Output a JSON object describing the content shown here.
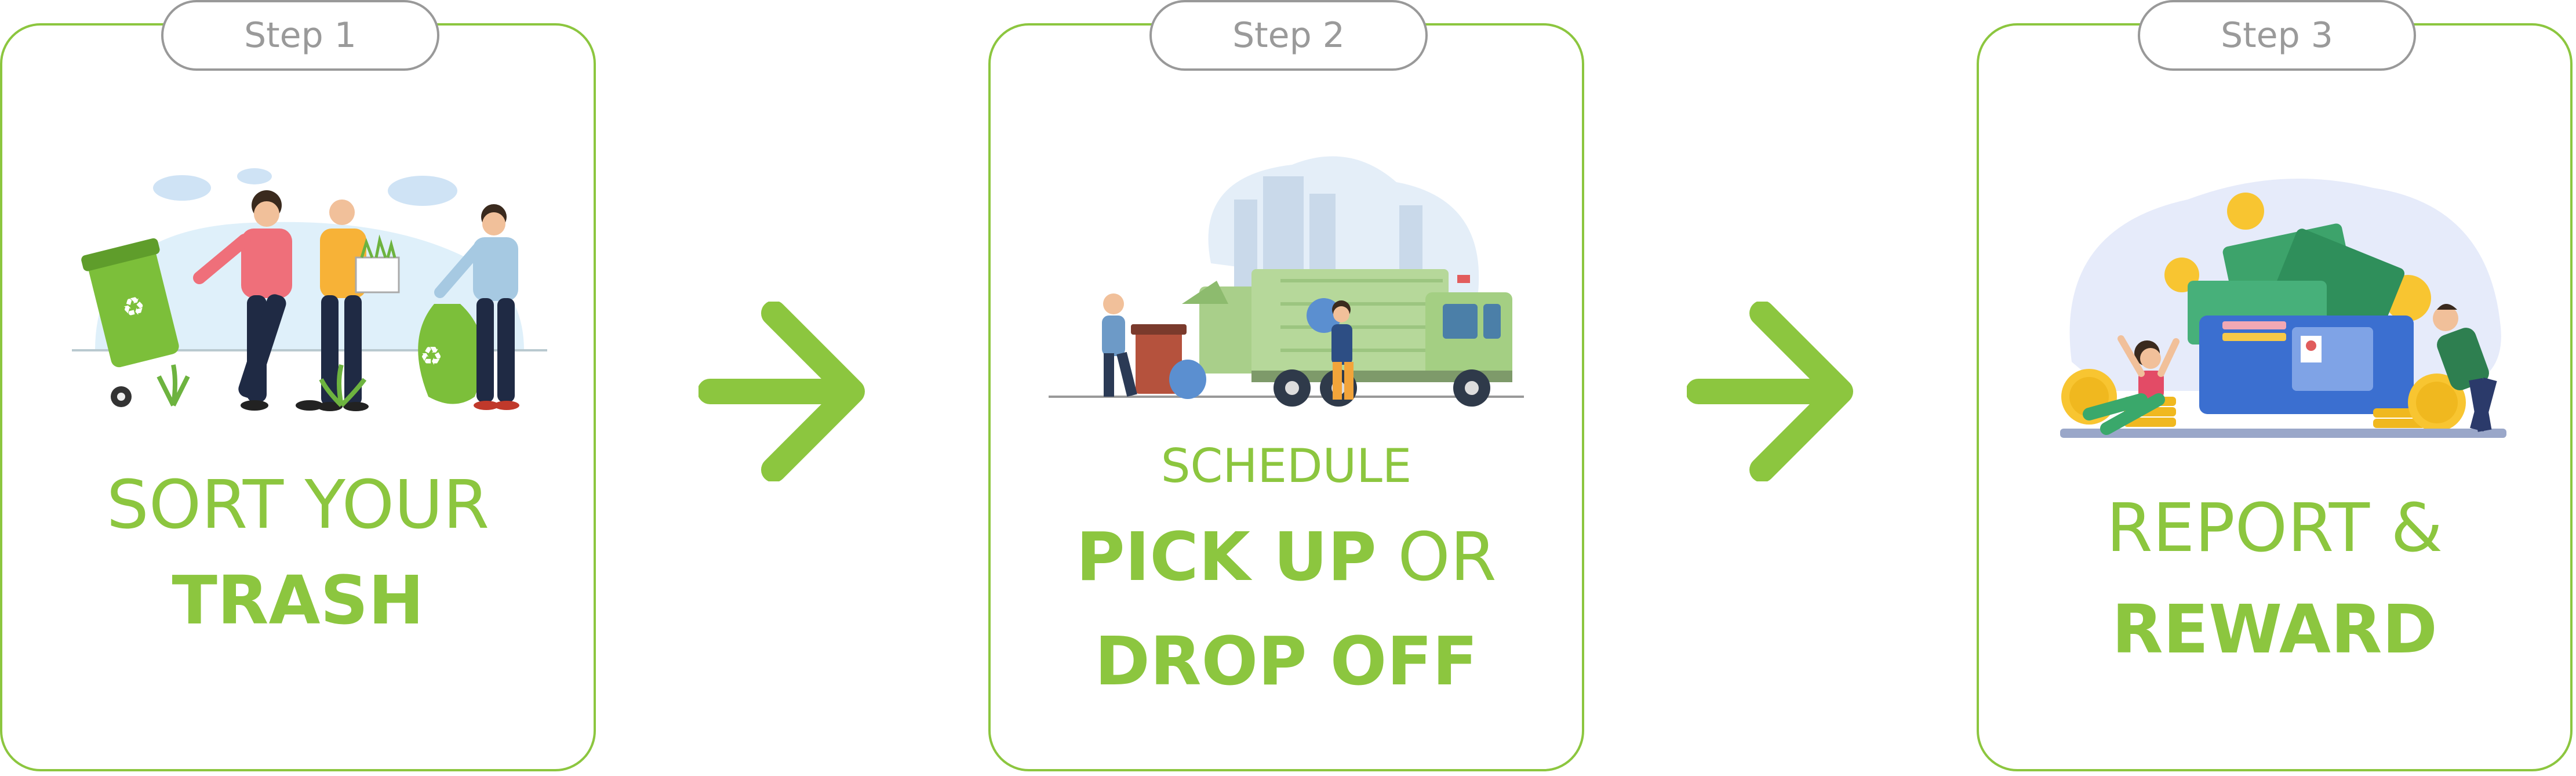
{
  "colors": {
    "accent": "#8cc63f",
    "pill_border": "#999999",
    "pill_text": "#9a9a9a"
  },
  "steps": [
    {
      "label": "Step 1",
      "line1_light": "SORT YOUR",
      "line2_bold": "TRASH"
    },
    {
      "label": "Step 2",
      "line0_light": "SCHEDULE",
      "line1_bold": "PICK UP",
      "line1_light": " OR",
      "line2_bold": "DROP OFF"
    },
    {
      "label": "Step 3",
      "line1_light": "REPORT &",
      "line2_bold": "REWARD"
    }
  ],
  "icons": [
    "people-sorting-trash-illustration",
    "garbage-truck-illustration",
    "money-reward-illustration",
    "arrow-right-icon"
  ]
}
